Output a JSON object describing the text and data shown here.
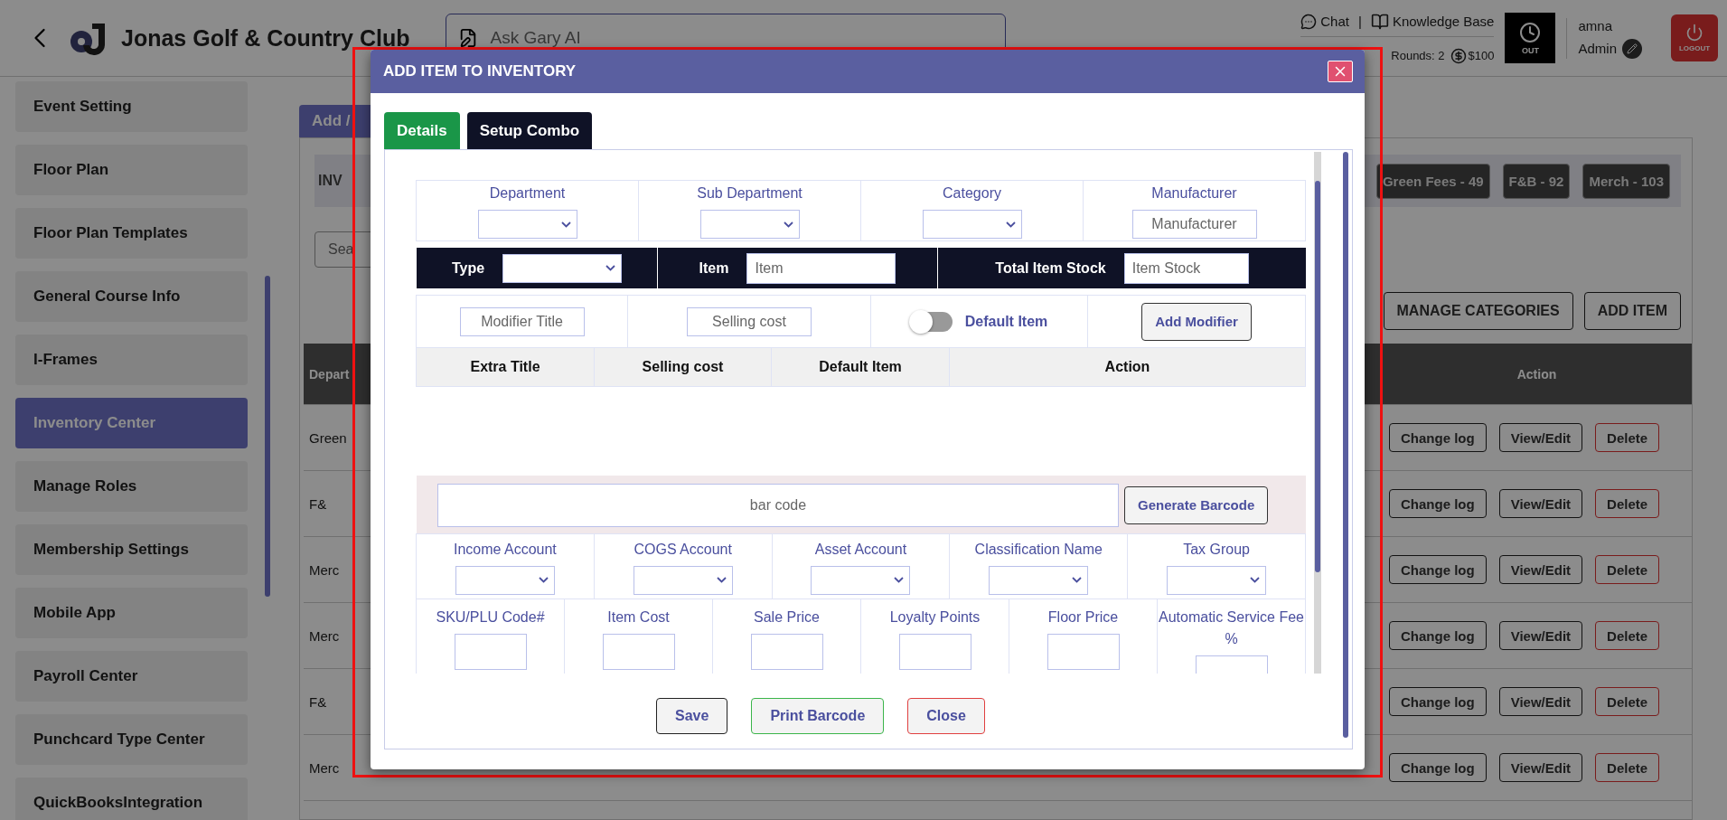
{
  "header": {
    "title": "Jonas Golf & Country Club",
    "ai_placeholder": "Ask Gary AI",
    "links": [
      "Chat",
      "Knowledge Base"
    ],
    "link_separator": "|",
    "rounds": "Rounds: 2",
    "balance": "$100",
    "clock_label": "OUT",
    "user": "amna",
    "role": "Admin",
    "logout": "LOGOUT"
  },
  "sidebar": {
    "items": [
      {
        "label": "Event Setting",
        "selected": false
      },
      {
        "label": "Floor Plan",
        "selected": false
      },
      {
        "label": "Floor Plan Templates",
        "selected": false
      },
      {
        "label": "General Course Info",
        "selected": false
      },
      {
        "label": "I-Frames",
        "selected": false
      },
      {
        "label": "Inventory Center",
        "selected": true
      },
      {
        "label": "Manage Roles",
        "selected": false
      },
      {
        "label": "Membership Settings",
        "selected": false
      },
      {
        "label": "Mobile App",
        "selected": false
      },
      {
        "label": "Payroll Center",
        "selected": false
      },
      {
        "label": "Punchcard Type Center",
        "selected": false
      },
      {
        "label": "QuickBooksIntegration",
        "selected": false
      }
    ]
  },
  "background": {
    "tab": "Add /",
    "panel_label": "INV",
    "badges": [
      "Green Fees - 49",
      "F&B - 92",
      "Merch - 103"
    ],
    "search_placeholder": "Sea",
    "buttons": [
      "MANAGE CATEGORIES",
      "ADD ITEM"
    ],
    "columns": [
      "Depart",
      "Action"
    ],
    "rows": [
      {
        "department": "Green",
        "actions": [
          "Change log",
          "View/Edit",
          "Delete"
        ]
      },
      {
        "department": "F&",
        "actions": [
          "Change log",
          "View/Edit",
          "Delete"
        ]
      },
      {
        "department": "Merc",
        "actions": [
          "Change log",
          "View/Edit",
          "Delete"
        ]
      },
      {
        "department": "Merc",
        "actions": [
          "Change log",
          "View/Edit",
          "Delete"
        ]
      },
      {
        "department": "F&",
        "actions": [
          "Change log",
          "View/Edit",
          "Delete"
        ]
      },
      {
        "department": "Merc",
        "actions": [
          "Change log",
          "View/Edit",
          "Delete"
        ]
      }
    ]
  },
  "modal": {
    "title": "ADD ITEM TO INVENTORY",
    "tabs": [
      {
        "label": "Details",
        "selected": true
      },
      {
        "label": "Setup Combo",
        "selected": false
      }
    ],
    "filters": [
      {
        "label": "Department",
        "kind": "select"
      },
      {
        "label": "Sub Department",
        "kind": "select"
      },
      {
        "label": "Category",
        "kind": "select"
      },
      {
        "label": "Manufacturer",
        "kind": "input",
        "placeholder": "Manufacturer"
      }
    ],
    "item_bar": [
      {
        "label": "Type",
        "kind": "select"
      },
      {
        "label": "Item",
        "kind": "input",
        "placeholder": "Item"
      },
      {
        "label": "Total Item Stock",
        "kind": "input",
        "placeholder": "Item Stock"
      }
    ],
    "modifier": {
      "title_placeholder": "Modifier Title",
      "cost_placeholder": "Selling cost",
      "toggle_label": "Default Item",
      "toggle_on": false,
      "add_button": "Add Modifier"
    },
    "extras_columns": [
      "Extra Title",
      "Selling cost",
      "Default Item",
      "Action"
    ],
    "barcode": {
      "placeholder": "bar code",
      "button": "Generate Barcode"
    },
    "accounts": [
      "Income Account",
      "COGS Account",
      "Asset Account",
      "Classification Name",
      "Tax Group"
    ],
    "pricing": [
      "SKU/PLU Code#",
      "Item Cost",
      "Sale Price",
      "Loyalty Points",
      "Floor Price",
      "Automatic Service Fee %"
    ],
    "footer_buttons": [
      {
        "label": "Save",
        "kind": "save"
      },
      {
        "label": "Print Barcode",
        "kind": "print"
      },
      {
        "label": "Close",
        "kind": "close"
      }
    ]
  }
}
